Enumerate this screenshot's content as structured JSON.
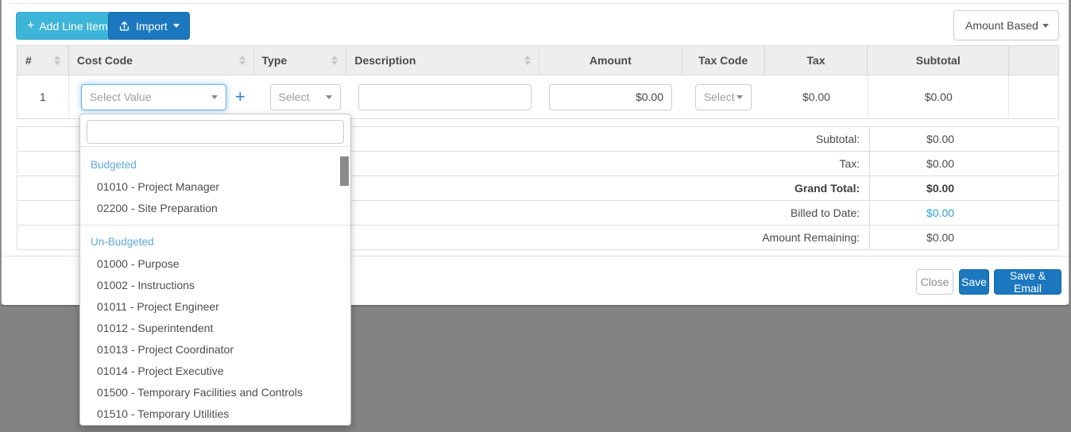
{
  "colors": {
    "accent_cyan": "#3cb5d8",
    "accent_blue": "#1b78be",
    "link_blue": "#2b9fd9",
    "group_header_blue": "#5fa8dc",
    "page_background": "#838383",
    "header_background": "#eeeeee"
  },
  "toolbar": {
    "plus_icon": "+",
    "add_line_item": "Add Line Item",
    "import": "Import",
    "view_mode": "Amount Based"
  },
  "table": {
    "columns": [
      "#",
      "Cost Code",
      "Type",
      "Description",
      "Amount",
      "Tax Code",
      "Tax",
      "Subtotal",
      ""
    ],
    "row": {
      "number": "1",
      "cost_code_placeholder": "Select Value",
      "add_cost_code_icon": "+",
      "type_placeholder": "Select",
      "description_value": "",
      "amount_value": "$0.00",
      "tax_code_placeholder": "Select",
      "tax": "$0.00",
      "subtotal": "$0.00"
    }
  },
  "summary": {
    "rows": [
      {
        "label": "Subtotal:",
        "value": "$0.00"
      },
      {
        "label": "Tax:",
        "value": "$0.00"
      },
      {
        "label": "Grand Total:",
        "value": "$0.00"
      },
      {
        "label": "Billed to Date:",
        "value": "$0.00"
      },
      {
        "label": "Amount Remaining:",
        "value": "$0.00"
      }
    ]
  },
  "cost_code_dropdown": {
    "search_value": "",
    "groups": [
      {
        "label": "Budgeted",
        "items": [
          "01010 - Project Manager",
          "02200 - Site Preparation"
        ]
      },
      {
        "label": "Un-Budgeted",
        "items": [
          "01000 - Purpose",
          "01002 - Instructions",
          "01011 - Project Engineer",
          "01012 - Superintendent",
          "01013 - Project Coordinator",
          "01014 - Project Executive",
          "01500 - Temporary Facilities and Controls",
          "01510 - Temporary Utilities"
        ]
      }
    ]
  },
  "footer": {
    "close": "Close",
    "save": "Save",
    "save_email": "Save & Email"
  }
}
